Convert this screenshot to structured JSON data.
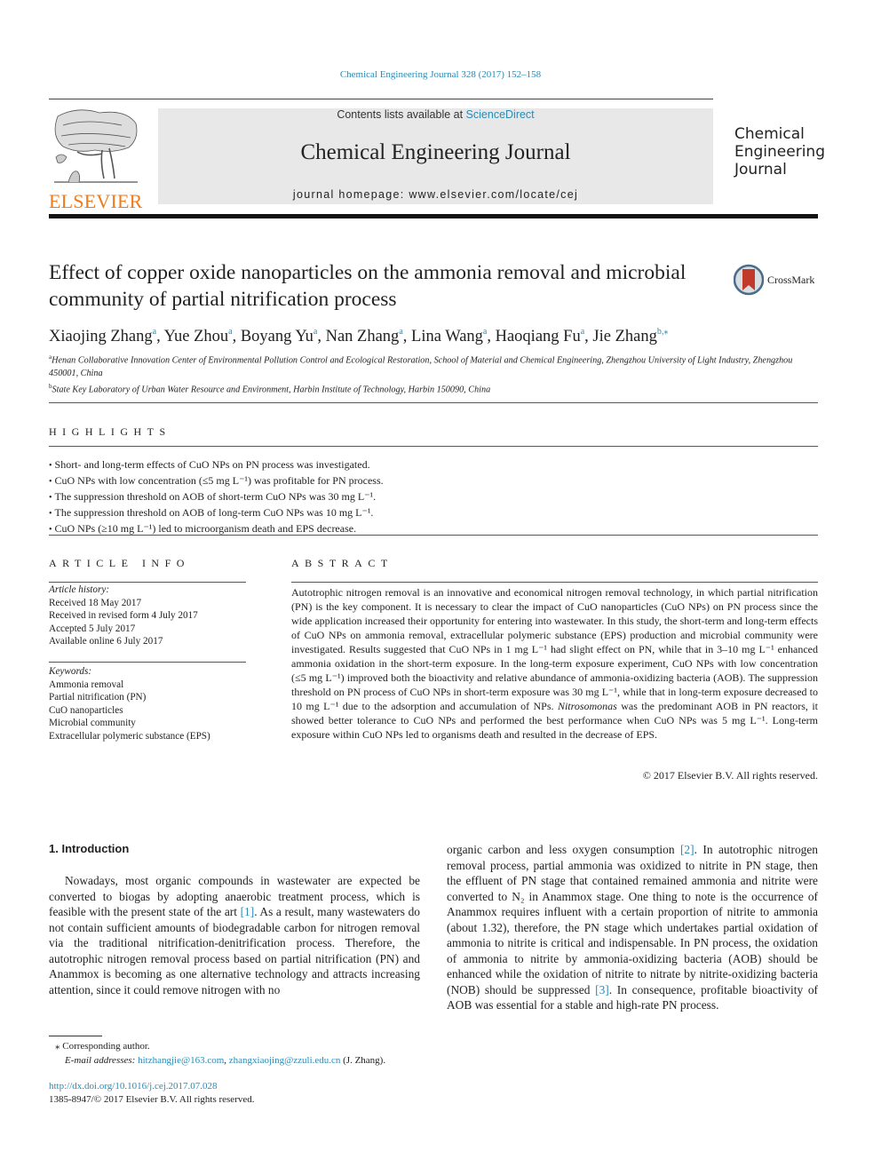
{
  "header": {
    "citation": "Chemical Engineering Journal 328 (2017) 152–158",
    "contents_prefix": "Contents lists available at ",
    "contents_link": "ScienceDirect",
    "journal_title": "Chemical Engineering Journal",
    "homepage": "journal homepage: www.elsevier.com/locate/cej",
    "publisher_logo_text": "ELSEVIER",
    "cover_title_lines": [
      "Chemical",
      "Engineering",
      "Journal"
    ],
    "brand_color": "#f07a1a",
    "link_color": "#2a8bb5"
  },
  "article": {
    "title": "Effect of copper oxide nanoparticles on the ammonia removal and microbial community of partial nitrification process",
    "crossmark_label": "CrossMark",
    "authors": [
      {
        "name": "Xiaojing Zhang",
        "aff": "a"
      },
      {
        "name": "Yue Zhou",
        "aff": "a"
      },
      {
        "name": "Boyang Yu",
        "aff": "a"
      },
      {
        "name": "Nan Zhang",
        "aff": "a"
      },
      {
        "name": "Lina Wang",
        "aff": "a"
      },
      {
        "name": "Haoqiang Fu",
        "aff": "a"
      },
      {
        "name": "Jie Zhang",
        "aff": "b,⁎"
      }
    ],
    "affiliations": [
      {
        "key": "a",
        "text": "Henan Collaborative Innovation Center of Environmental Pollution Control and Ecological Restoration, School of Material and Chemical Engineering, Zhengzhou University of Light Industry, Zhengzhou 450001, China"
      },
      {
        "key": "b",
        "text": "State Key Laboratory of Urban Water Resource and Environment, Harbin Institute of Technology, Harbin 150090, China"
      }
    ]
  },
  "highlights": {
    "heading": "HIGHLIGHTS",
    "items": [
      "Short- and long-term effects of CuO NPs on PN process was investigated.",
      "CuO NPs with low concentration (≤5 mg L⁻¹) was profitable for PN process.",
      "The suppression threshold on AOB of short-term CuO NPs was 30 mg L⁻¹.",
      "The suppression threshold on AOB of long-term CuO NPs was 10 mg L⁻¹.",
      "CuO NPs (≥10 mg L⁻¹) led to microorganism death and EPS decrease."
    ]
  },
  "article_info": {
    "heading": "ARTICLE INFO",
    "history_label": "Article history:",
    "history": [
      "Received 18 May 2017",
      "Received in revised form 4 July 2017",
      "Accepted 5 July 2017",
      "Available online 6 July 2017"
    ],
    "keywords_label": "Keywords:",
    "keywords": [
      "Ammonia removal",
      "Partial nitrification (PN)",
      "CuO nanoparticles",
      "Microbial community",
      "Extracellular polymeric substance (EPS)"
    ]
  },
  "abstract": {
    "heading": "ABSTRACT",
    "text_1": "Autotrophic nitrogen removal is an innovative and economical nitrogen removal technology, in which partial nitrification (PN) is the key component. It is necessary to clear the impact of CuO nanoparticles (CuO NPs) on PN process since the wide application increased their opportunity for entering into wastewater. In this study, the short-term and long-term effects of CuO NPs on ammonia removal, extracellular polymeric substance (EPS) production and microbial community were investigated. Results suggested that CuO NPs in 1 mg L⁻¹ had slight effect on PN, while that in 3–10 mg L⁻¹ enhanced ammonia oxidation in the short-term exposure. In the long-term exposure experiment, CuO NPs with low concentration (≤5 mg L⁻¹) improved both the bioactivity and relative abundance of ammonia-oxidizing bacteria (AOB). The suppression threshold on PN process of CuO NPs in short-term exposure was 30 mg L⁻¹, while that in long-term exposure decreased to 10 mg L⁻¹ due to the adsorption and accumulation of NPs. ",
    "italic_term": "Nitrosomonas",
    "text_2": " was the predominant AOB in PN reactors, it showed better tolerance to CuO NPs and performed the best performance when CuO NPs was 5 mg L⁻¹. Long-term exposure within CuO NPs led to organisms death and resulted in the decrease of EPS.",
    "copyright": "© 2017 Elsevier B.V. All rights reserved."
  },
  "introduction": {
    "heading": "1. Introduction",
    "p1_a": "Nowadays, most organic compounds in wastewater are expected be converted to biogas by adopting anaerobic treatment process, which is feasible with the present state of the art ",
    "ref1": "[1]",
    "p1_b": ". As a result, many wastewaters do not contain sufficient amounts of biodegradable carbon for nitrogen removal via the traditional nitrification-denitrification process. Therefore, the autotrophic nitrogen removal process based on partial nitrification (PN) and Anammox is becoming as one alternative technology and attracts increasing attention, since it could remove nitrogen with no organic carbon and less oxygen consumption ",
    "ref2": "[2]",
    "p1_c": ". In autotrophic nitrogen removal process, partial ammonia was oxidized to nitrite in PN stage, then the effluent of PN stage that contained remained ammonia and nitrite were converted to N₂ in Anammox stage. One thing to note is the occurrence of Anammox requires influent with a certain proportion of nitrite to ammonia (about 1.32), therefore, the PN stage which undertakes partial oxidation of ammonia to nitrite is critical and indispensable. In PN process, the oxidation of ammonia to nitrite by ammonia-oxidizing bacteria (AOB) should be enhanced while the oxidation of nitrite to nitrate by nitrite-oxidizing bacteria (NOB) should be suppressed ",
    "ref3": "[3]",
    "p1_d": ". In consequence, profitable bioactivity of AOB was essential for a stable and high-rate PN process."
  },
  "footer": {
    "corresponding": "⁎ Corresponding author.",
    "email_label": "E-mail addresses: ",
    "email_1": "hitzhangjie@163.com",
    "email_2": "zhangxiaojing@zzuli.edu.cn",
    "email_suffix": " (J. Zhang).",
    "doi": "http://dx.doi.org/10.1016/j.cej.2017.07.028",
    "issn": "1385-8947/© 2017 Elsevier B.V. All rights reserved."
  }
}
